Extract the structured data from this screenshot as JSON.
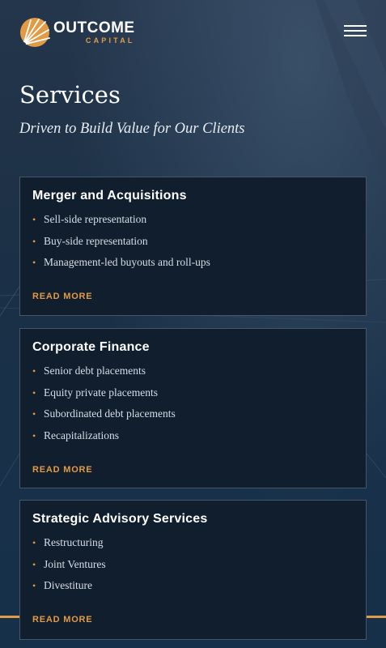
{
  "brand": {
    "name_primary": "OUTCOME",
    "name_secondary": "CAPITAL",
    "icon": "sunburst-logo-mark",
    "accent_color": "#e39a45",
    "background_color": "#0f1d2c"
  },
  "header": {
    "menu_icon": "hamburger-menu-icon"
  },
  "page": {
    "title": "Services",
    "subtitle": "Driven to Build Value for Our Clients"
  },
  "services": [
    {
      "title": "Merger and Acquisitions",
      "items": [
        "Sell-side representation",
        "Buy-side representation",
        "Management-led buyouts and roll-ups"
      ],
      "link_label": "READ MORE"
    },
    {
      "title": "Corporate Finance",
      "items": [
        "Senior debt placements",
        "Equity private placements",
        "Subordinated debt placements",
        "Recapitalizations"
      ],
      "link_label": "READ MORE"
    },
    {
      "title": "Strategic Advisory Services",
      "items": [
        "Restructuring",
        "Joint Ventures",
        "Divestiture"
      ],
      "link_label": "READ MORE"
    }
  ]
}
